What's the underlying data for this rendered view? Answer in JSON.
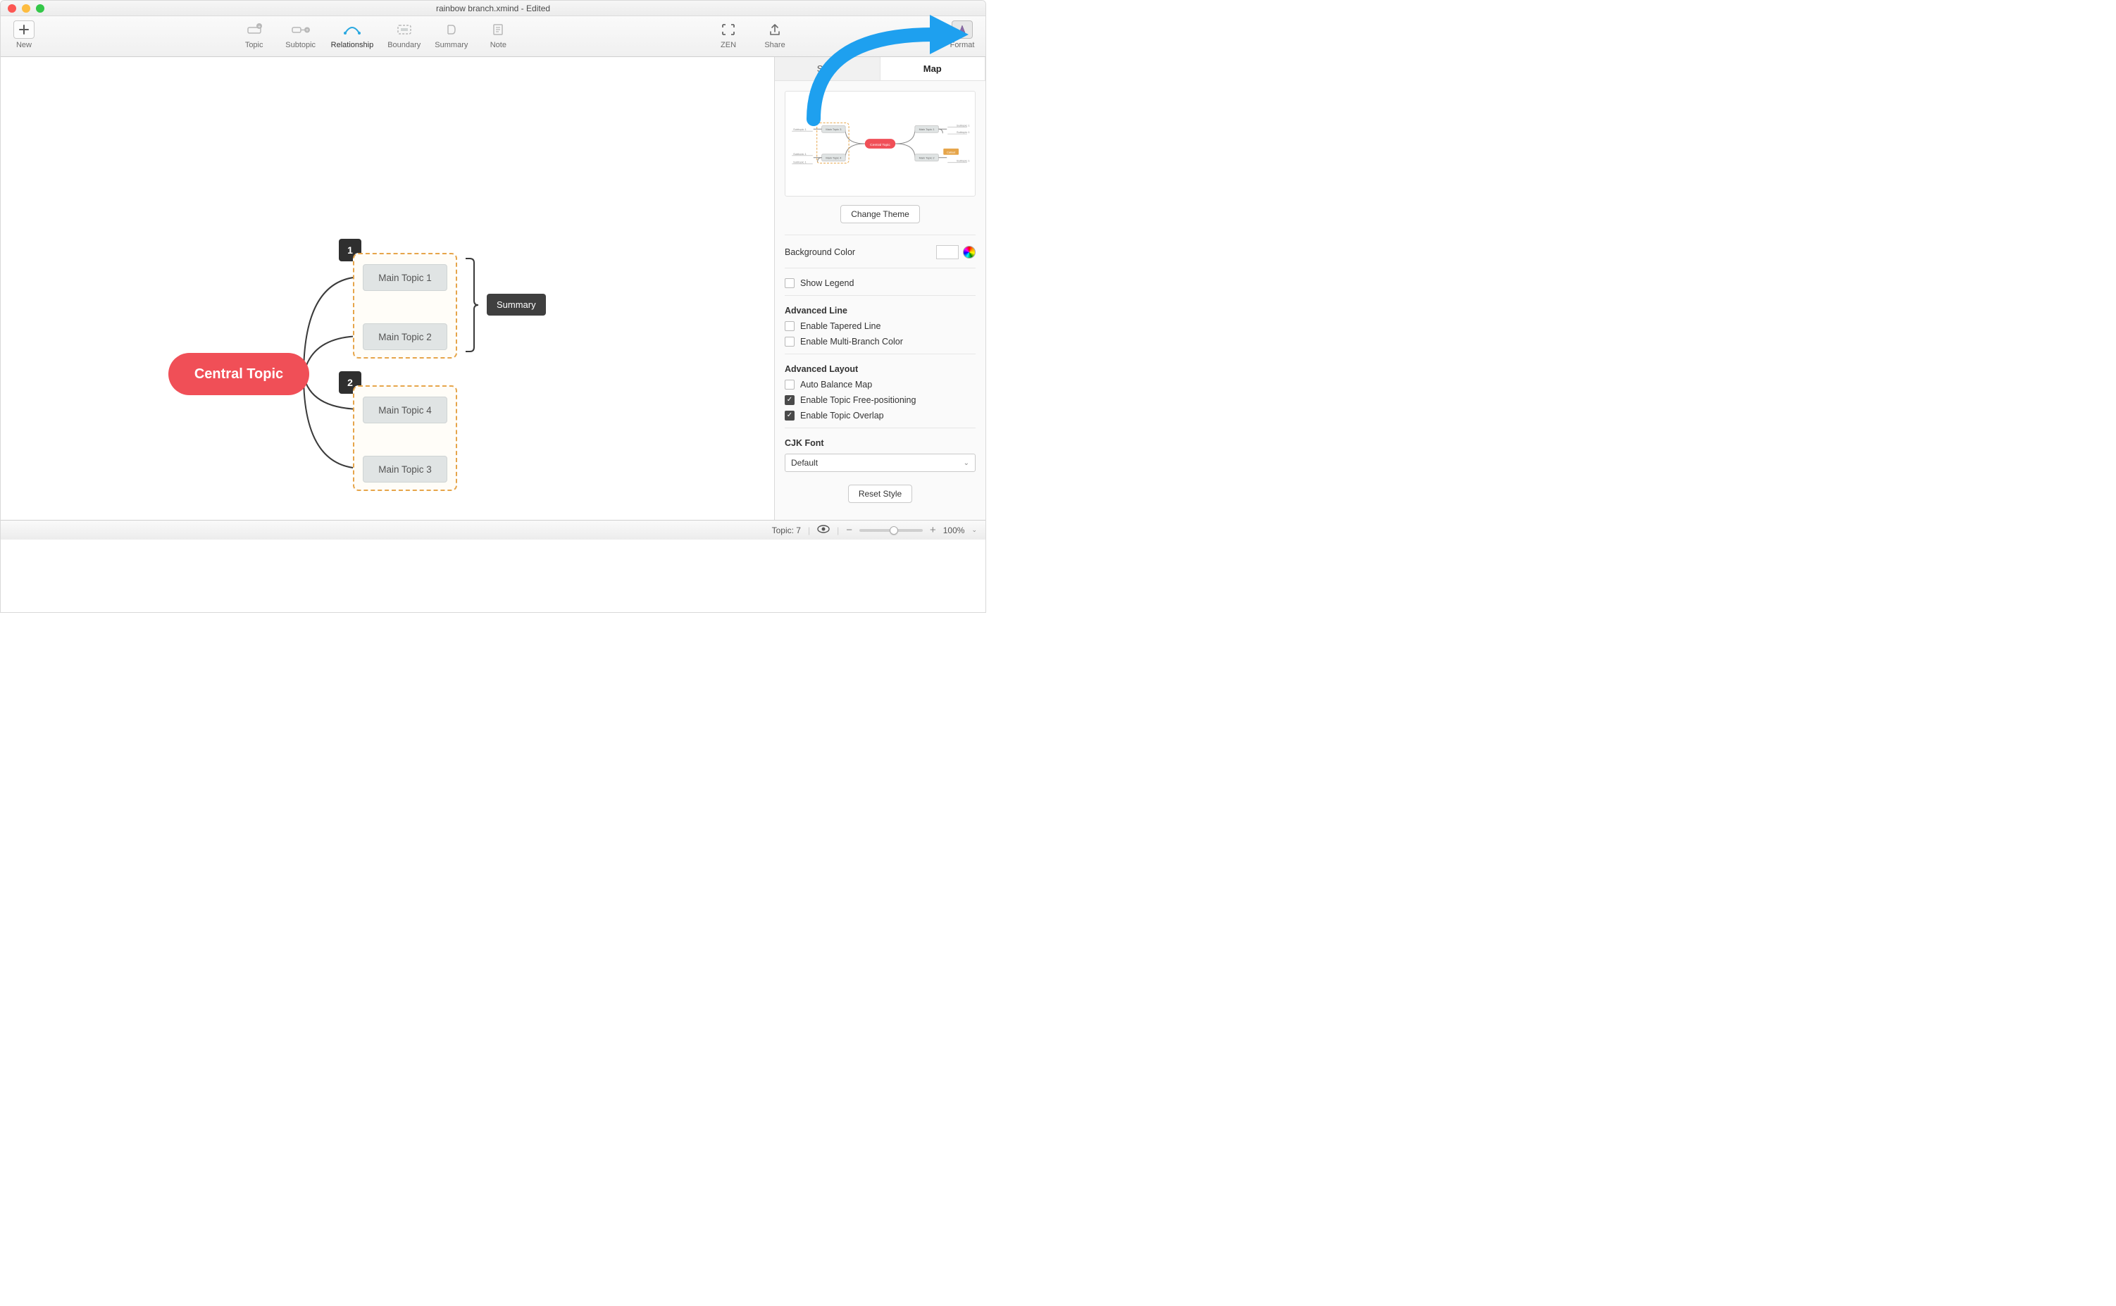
{
  "window": {
    "title": "rainbow branch.xmind - Edited"
  },
  "toolbar": {
    "new": "New",
    "topic": "Topic",
    "subtopic": "Subtopic",
    "relationship": "Relationship",
    "boundary": "Boundary",
    "summary": "Summary",
    "note": "Note",
    "zen": "ZEN",
    "share": "Share",
    "format": "Format"
  },
  "mindmap": {
    "central": "Central Topic",
    "badge1": "1",
    "badge2": "2",
    "topics": {
      "t1": "Main Topic 1",
      "t2": "Main Topic 2",
      "t3": "Main Topic 3",
      "t4": "Main Topic 4"
    },
    "summary": "Summary",
    "preview": {
      "central": "Central Topic",
      "mt1": "Main Topic 1",
      "mt2": "Main Topic 2",
      "mt3": "Main Topic 3",
      "mt4": "Main Topic 4",
      "sub": "Subtopic 1",
      "callout": "Callout"
    }
  },
  "sidebar": {
    "tabs": {
      "style": "Style",
      "map": "Map"
    },
    "change_theme": "Change Theme",
    "bg_color": "Background Color",
    "show_legend": "Show Legend",
    "adv_line": {
      "title": "Advanced Line",
      "tapered": "Enable Tapered Line",
      "multi": "Enable Multi-Branch Color"
    },
    "adv_layout": {
      "title": "Advanced Layout",
      "auto": "Auto Balance Map",
      "free": "Enable Topic Free-positioning",
      "overlap": "Enable Topic Overlap"
    },
    "cjk": {
      "title": "CJK Font",
      "value": "Default"
    },
    "reset": "Reset Style"
  },
  "status": {
    "topic_count": "Topic: 7",
    "zoom": "100%"
  }
}
